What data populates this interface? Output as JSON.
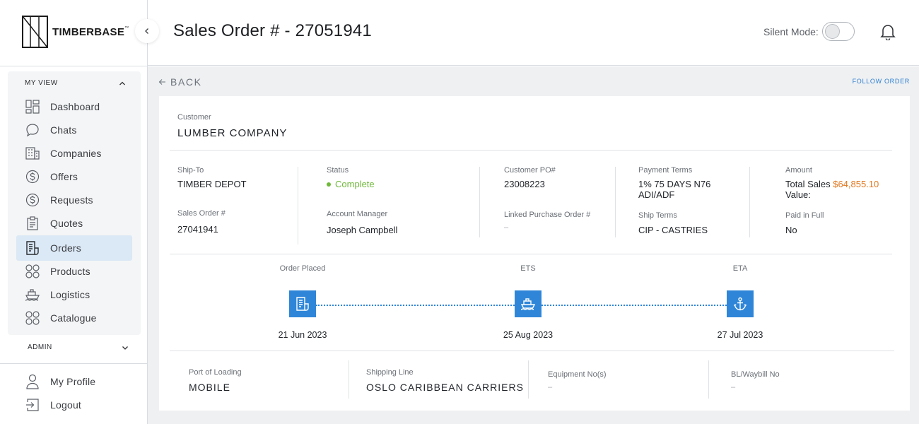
{
  "brand": {
    "name": "TIMBERBASE",
    "tm": "™"
  },
  "header": {
    "title": "Sales Order # - 27051941",
    "silent_mode_label": "Silent Mode:"
  },
  "sidebar": {
    "my_view_label": "MY VIEW",
    "admin_label": "ADMIN",
    "items": [
      {
        "label": "Dashboard",
        "icon": "dashboard-icon"
      },
      {
        "label": "Chats",
        "icon": "chat-bubble-icon"
      },
      {
        "label": "Companies",
        "icon": "building-icon"
      },
      {
        "label": "Offers",
        "icon": "dollar-circle-icon"
      },
      {
        "label": "Requests",
        "icon": "dollar-circle-icon"
      },
      {
        "label": "Quotes",
        "icon": "clipboard-icon"
      },
      {
        "label": "Orders",
        "icon": "receipt-icon",
        "active": true
      },
      {
        "label": "Products",
        "icon": "grid-circles-icon"
      },
      {
        "label": "Logistics",
        "icon": "ship-icon"
      },
      {
        "label": "Catalogue",
        "icon": "grid-circles-icon"
      }
    ],
    "footer": [
      {
        "label": "My Profile",
        "icon": "user-icon"
      },
      {
        "label": "Logout",
        "icon": "logout-icon"
      }
    ]
  },
  "content": {
    "back_label": "BACK",
    "follow_label": "FOLLOW ORDER",
    "customer": {
      "label": "Customer",
      "value": "LUMBER COMPANY"
    },
    "details": {
      "ship_to": {
        "label": "Ship-To",
        "value": "TIMBER DEPOT"
      },
      "sales_order": {
        "label": "Sales Order #",
        "value": "27041941"
      },
      "status": {
        "label": "Status",
        "value": "Complete",
        "color": "#6fb83a"
      },
      "account_manager": {
        "label": "Account Manager",
        "value": "Joseph Campbell"
      },
      "customer_po": {
        "label": "Customer PO#",
        "value": "23008223"
      },
      "linked_po": {
        "label": "Linked Purchase Order #",
        "value": "–"
      },
      "payment_terms": {
        "label": "Payment Terms",
        "value_line1": "1% 75 DAYS N76",
        "value_line2": "ADI/ADF"
      },
      "ship_terms": {
        "label": "Ship Terms",
        "value": "CIP - CASTRIES"
      },
      "amount": {
        "label": "Amount",
        "total_label_line1": "Total Sales",
        "total_label_line2": "Value:",
        "value": "$64,855.10",
        "color": "#e2771f"
      },
      "paid_in_full": {
        "label": "Paid in Full",
        "value": "No"
      }
    },
    "timeline": [
      {
        "label": "Order Placed",
        "date": "21 Jun 2023",
        "icon": "receipt-icon"
      },
      {
        "label": "ETS",
        "date": "25 Aug 2023",
        "icon": "ship-icon"
      },
      {
        "label": "ETA",
        "date": "27 Jul 2023",
        "icon": "anchor-icon"
      }
    ],
    "shipping": {
      "port_of_loading": {
        "label": "Port of Loading",
        "value": "MOBILE"
      },
      "shipping_line": {
        "label": "Shipping Line",
        "value": "OSLO CARIBBEAN CARRIERS"
      },
      "equipment_no": {
        "label": "Equipment No(s)",
        "value": "–"
      },
      "bl_waybill": {
        "label": "BL/Waybill No",
        "value": "–"
      }
    }
  },
  "colors": {
    "accent": "#2f86d8",
    "active_nav_bg": "#dbe8f5"
  }
}
